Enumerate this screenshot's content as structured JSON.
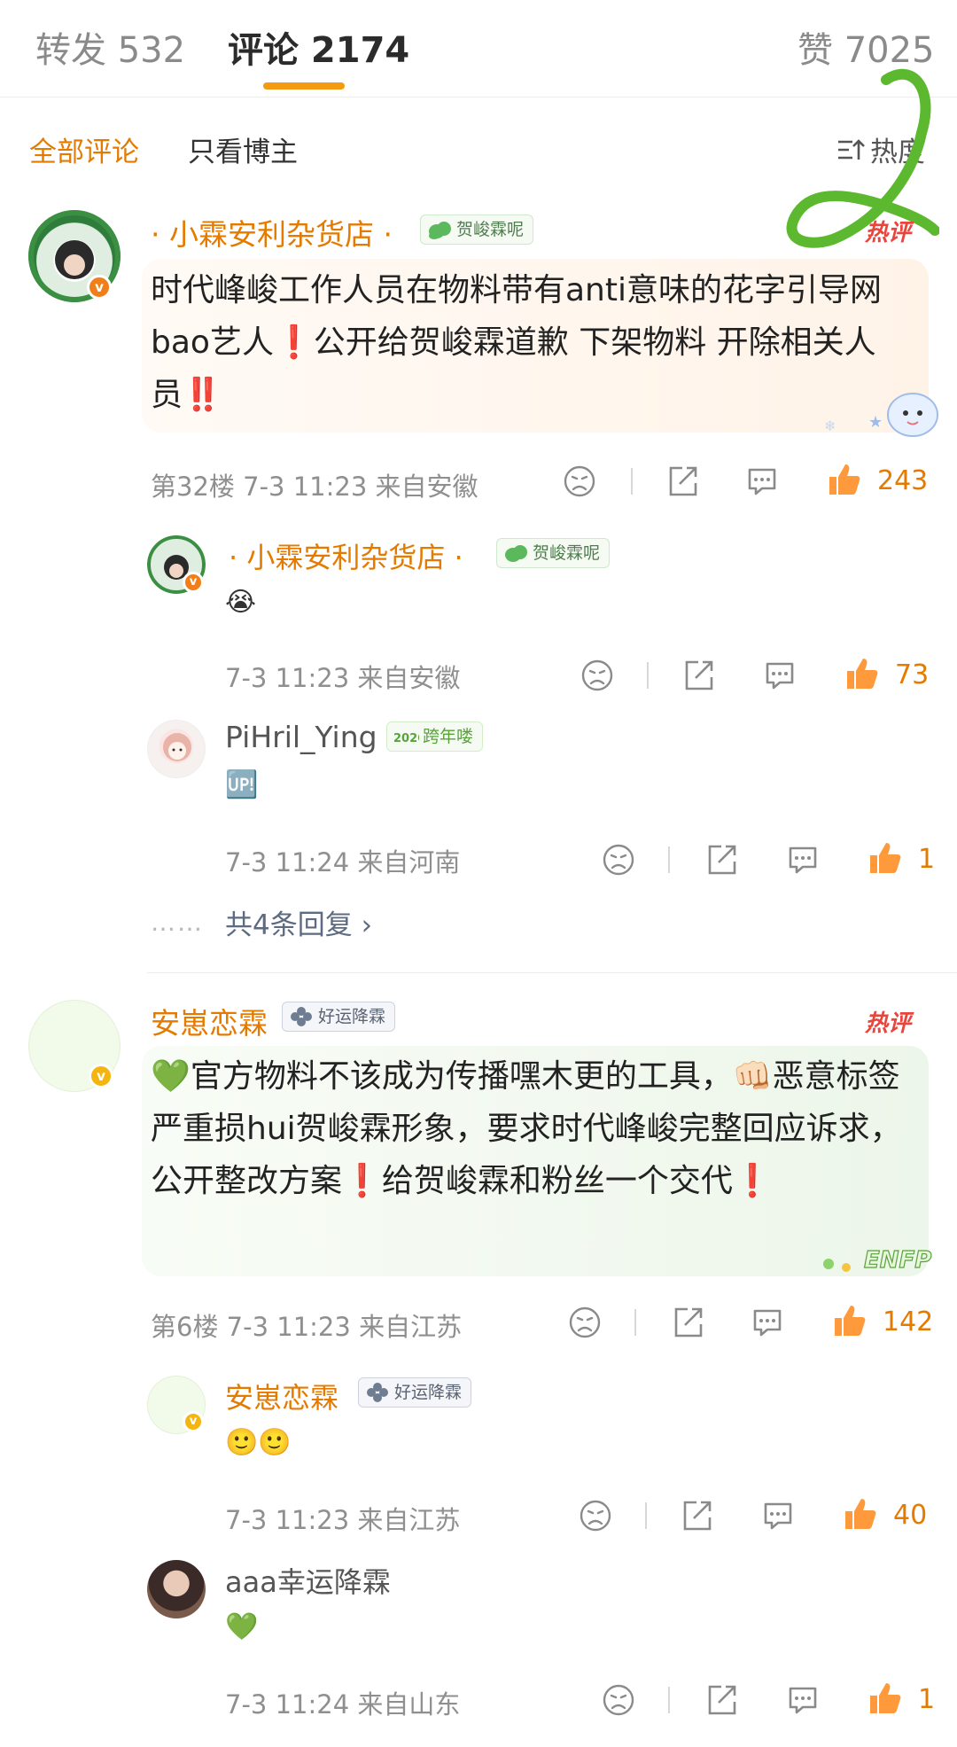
{
  "tabs": {
    "repost": "转发 532",
    "comments": "评论 2174",
    "likes": "赞 7025"
  },
  "filters": {
    "all": "全部评论",
    "author_only": "只看博主",
    "sort": "热度"
  },
  "hot_label": "热评",
  "comment1": {
    "user": "· 小霖安利杂货店 ·",
    "badge": "贺峻霖呢",
    "text_a": "时代峰峻工作人员在物料带有anti意味的花字引导网bao艺人",
    "mark1": "❗",
    "text_b": "公开给贺峻霖道歉 下架物料 开除相关人员",
    "mark2": "‼️",
    "floor": "第32楼",
    "time": "7-3 11:23",
    "location": "来自安徽",
    "likes": "243",
    "replies": [
      {
        "user": "· 小霖安利杂货店 ·",
        "badge": "贺峻霖呢",
        "text": "😭",
        "time": "7-3 11:23",
        "location": "来自安徽",
        "likes": "73"
      },
      {
        "user": "PiHril_Ying",
        "badge": "跨年喽",
        "text": "🆙",
        "time": "7-3 11:24",
        "location": "来自河南",
        "likes": "1"
      }
    ],
    "dots": "……",
    "more": "共4条回复"
  },
  "comment2": {
    "user": "安崽恋霖",
    "badge": "好运降霖",
    "lead": "💚",
    "text_a": "官方物料不该成为传播嘿木更的工具，",
    "fist": "👊🏻",
    "text_b": "恶意标签严重损hui贺峻霖形象，要求时代峰峻完整回应诉求，公开整改方案",
    "mark1": "❗",
    "text_c": "给贺峻霖和粉丝一个交代",
    "mark2": "❗",
    "floor": "第6楼",
    "time": "7-3 11:23",
    "location": "来自江苏",
    "likes": "142",
    "replies": [
      {
        "user": "安崽恋霖",
        "badge": "好运降霖",
        "text": "🙂🙂",
        "time": "7-3 11:23",
        "location": "来自江苏",
        "likes": "40"
      },
      {
        "user": "aaa幸运降霖",
        "text": "💚",
        "time": "7-3 11:24",
        "location": "来自山东",
        "likes": "1"
      }
    ]
  },
  "colors": {
    "accent": "#e57a00",
    "tab_underline": "#f39c12",
    "hot": "#e8453c",
    "annotation": "#5cb82e"
  },
  "icons": [
    "dislike-icon",
    "share-icon",
    "reply-icon",
    "like-icon",
    "sort-icon",
    "clover-icon",
    "verified-icon"
  ]
}
